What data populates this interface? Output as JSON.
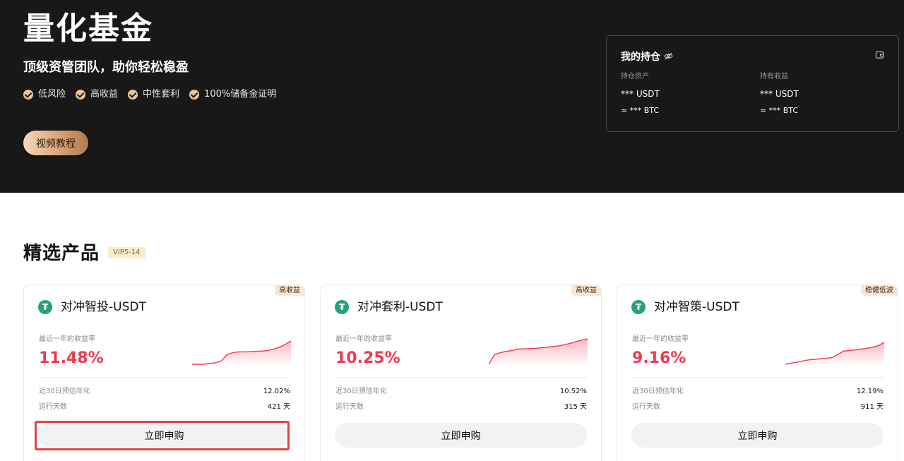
{
  "hero": {
    "title": "量化基金",
    "subtitle": "顶级资管团队，助你轻松稳盈",
    "features": [
      "低风险",
      "高收益",
      "中性套利",
      "100%储备金证明"
    ],
    "video_button": "视频教程"
  },
  "holdings": {
    "title": "我的持仓",
    "position_label": "持仓资产",
    "position_value": "*** USDT",
    "position_btc": "≈ *** BTC",
    "profit_label": "持有收益",
    "profit_value": "*** USDT",
    "profit_btc": "≈ *** BTC",
    "icons": [
      "eye-hidden-icon",
      "wallet-icon"
    ]
  },
  "section": {
    "title": "精选产品",
    "badge": "VIP5-14"
  },
  "products": [
    {
      "tag": "高收益",
      "title": "对冲智投-USDT",
      "rate_label": "最近一年的收益率",
      "rate": "11.48%",
      "apy_label": "近30日预估年化",
      "apy": "12.02%",
      "days_label": "运行天数",
      "days": "421 天",
      "button": "立即申购",
      "spark": [
        0,
        0,
        0,
        0.03,
        0.05,
        0.12,
        0.35,
        0.42,
        0.45,
        0.45,
        0.46,
        0.47,
        0.48,
        0.5,
        0.55,
        0.62,
        0.72,
        0.85
      ]
    },
    {
      "tag": "高收益",
      "title": "对冲套利-USDT",
      "rate_label": "最近一年的收益率",
      "rate": "10.25%",
      "apy_label": "近30日预估年化",
      "apy": "10.52%",
      "days_label": "运行天数",
      "days": "315 天",
      "button": "立即申购",
      "spark": [
        0,
        0.35,
        0.42,
        0.47,
        0.5,
        0.55,
        0.56,
        0.57,
        0.58,
        0.6,
        0.62,
        0.64,
        0.67,
        0.71,
        0.76,
        0.82,
        0.88,
        0.92
      ]
    },
    {
      "tag": "稳健低波",
      "title": "对冲智策-USDT",
      "rate_label": "最近一年的收益率",
      "rate": "9.16%",
      "apy_label": "近30日预估年化",
      "apy": "12.19%",
      "days_label": "运行天数",
      "days": "911 天",
      "button": "立即申购",
      "spark": [
        0,
        0.04,
        0.08,
        0.12,
        0.16,
        0.18,
        0.2,
        0.22,
        0.24,
        0.35,
        0.48,
        0.5,
        0.52,
        0.55,
        0.58,
        0.62,
        0.68,
        0.8
      ]
    }
  ],
  "colors": {
    "hero_bg": "#181818",
    "accent_gold": "#e9c79a",
    "rate_red": "#f0394f",
    "tether_green": "#26a17b"
  }
}
